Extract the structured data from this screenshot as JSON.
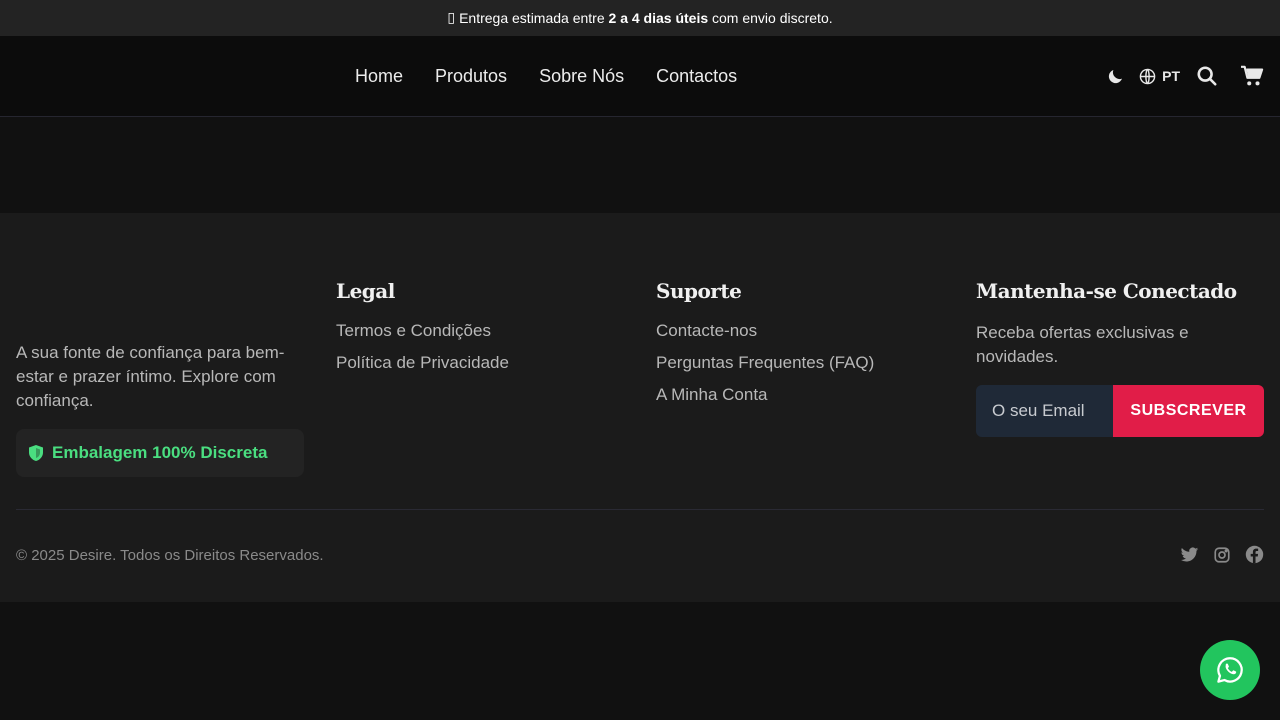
{
  "announcement": {
    "glyph": "▯",
    "prefix": "Entrega estimada entre",
    "highlight": "2 a 4 dias úteis",
    "suffix": "com envio discreto."
  },
  "nav": {
    "items": [
      {
        "label": "Home"
      },
      {
        "label": "Produtos"
      },
      {
        "label": "Sobre Nós"
      },
      {
        "label": "Contactos"
      }
    ]
  },
  "header_tools": {
    "theme_icon": "moon-icon",
    "language_icon": "globe-icon",
    "language_code": "PT",
    "search_icon": "search-icon",
    "cart_icon": "cart-icon"
  },
  "footer": {
    "about": {
      "text": "A sua fonte de confiança para bem-estar e prazer íntimo. Explore com confiança.",
      "badge_icon": "shield-icon",
      "badge_label": "Embalagem 100% Discreta"
    },
    "legal": {
      "heading": "Legal",
      "links": [
        "Termos e Condições",
        "Política de Privacidade"
      ]
    },
    "support": {
      "heading": "Suporte",
      "links": [
        "Contacte-nos",
        "Perguntas Frequentes (FAQ)",
        "A Minha Conta"
      ]
    },
    "newsletter": {
      "heading": "Mantenha-se Conectado",
      "text": "Receba ofertas exclusivas e novidades.",
      "email_placeholder": "O seu Email",
      "button_label": "SUBSCREVER"
    },
    "copyright": "© 2025 Desire. Todos os Direitos Reservados.",
    "social_icons": [
      "twitter-icon",
      "instagram-icon",
      "facebook-icon"
    ]
  },
  "floating": {
    "whatsapp_icon": "whatsapp-icon"
  },
  "colors": {
    "accent": "#e11d48",
    "badge_green": "#4ade80",
    "whatsapp_green": "#22c55e",
    "background": "#111111",
    "footer_background": "#1b1b1b"
  }
}
